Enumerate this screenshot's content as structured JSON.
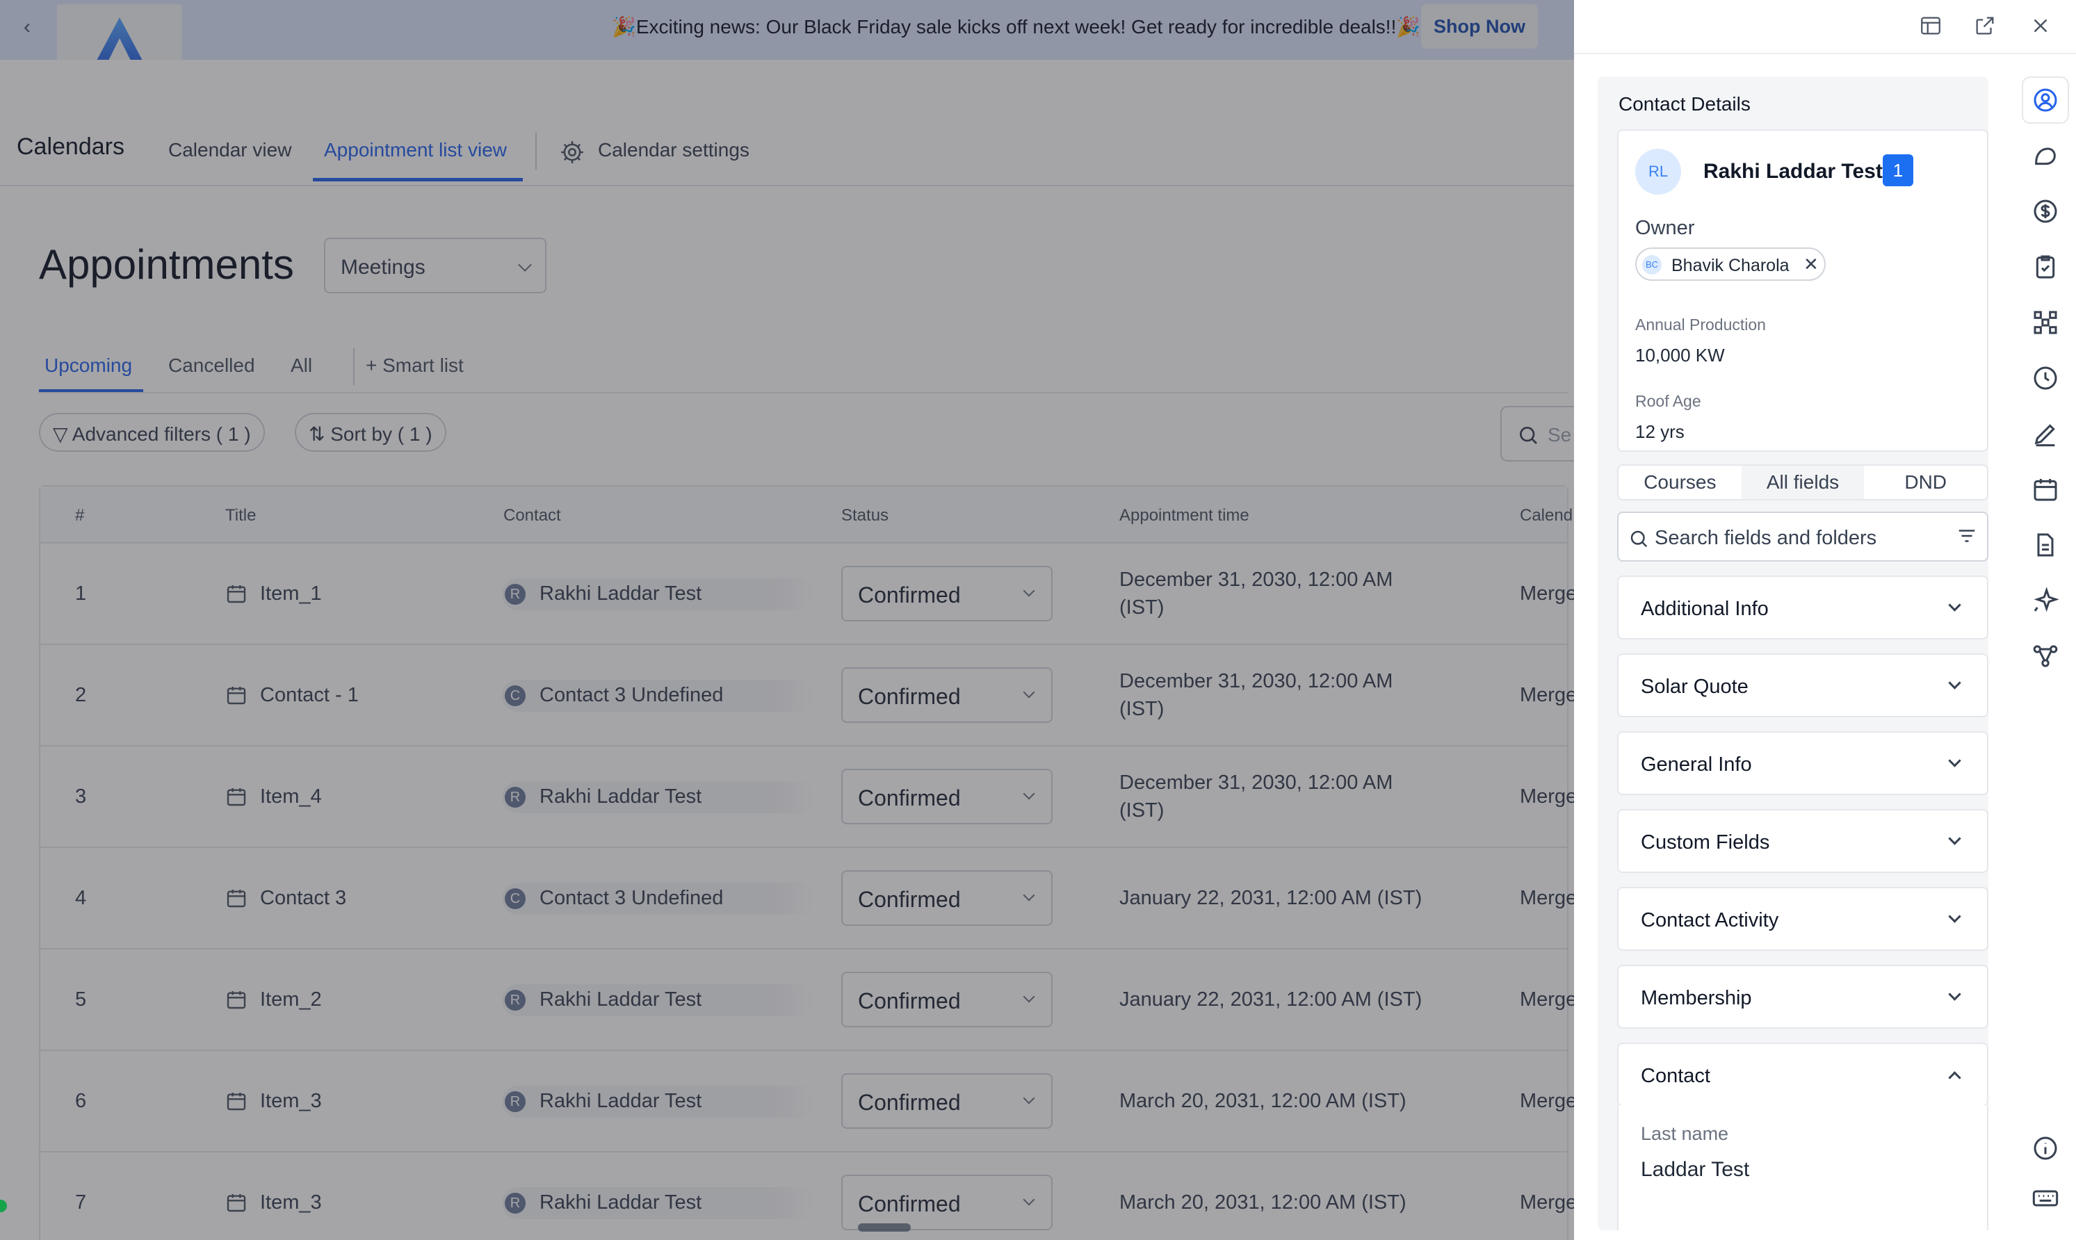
{
  "banner": {
    "message": "🎉Exciting news: Our Black Friday sale kicks off next week! Get ready for incredible deals!!🎉",
    "shop_button": "Shop Now"
  },
  "nav": {
    "brand": "Calendars",
    "tabs": [
      "Calendar view",
      "Appointment list view",
      "Calendar settings"
    ],
    "active_tab": "Appointment list view"
  },
  "page": {
    "title": "Appointments",
    "calendar_select": "Meetings"
  },
  "list_tabs": {
    "items": [
      "Upcoming",
      "Cancelled",
      "All"
    ],
    "active": "Upcoming",
    "smart_list": "+ Smart list"
  },
  "filters": {
    "advanced": "Advanced filters ( 1 )",
    "sort": "Sort by ( 1 )",
    "search_placeholder": "Se"
  },
  "table": {
    "columns": [
      "#",
      "Title",
      "Contact",
      "Status",
      "Appointment time",
      "Calend"
    ],
    "rows": [
      {
        "num": "1",
        "title": "Item_1",
        "contact_initial": "R",
        "contact": "Rakhi Laddar Test",
        "status": "Confirmed",
        "time1": "December 31, 2030, 12:00 AM",
        "time2": "(IST)",
        "calendar": "Merge"
      },
      {
        "num": "2",
        "title": "Contact - 1",
        "contact_initial": "C",
        "contact": "Contact 3 Undefined",
        "status": "Confirmed",
        "time1": "December 31, 2030, 12:00 AM",
        "time2": "(IST)",
        "calendar": "Merge"
      },
      {
        "num": "3",
        "title": "Item_4",
        "contact_initial": "R",
        "contact": "Rakhi Laddar Test",
        "status": "Confirmed",
        "time1": "December 31, 2030, 12:00 AM",
        "time2": "(IST)",
        "calendar": "Merge"
      },
      {
        "num": "4",
        "title": "Contact 3",
        "contact_initial": "C",
        "contact": "Contact 3 Undefined",
        "status": "Confirmed",
        "time1": "January 22, 2031, 12:00 AM (IST)",
        "time2": "",
        "calendar": "Merge"
      },
      {
        "num": "5",
        "title": "Item_2",
        "contact_initial": "R",
        "contact": "Rakhi Laddar Test",
        "status": "Confirmed",
        "time1": "January 22, 2031, 12:00 AM (IST)",
        "time2": "",
        "calendar": "Merge"
      },
      {
        "num": "6",
        "title": "Item_3",
        "contact_initial": "R",
        "contact": "Rakhi Laddar Test",
        "status": "Confirmed",
        "time1": "March 20, 2031, 12:00 AM (IST)",
        "time2": "",
        "calendar": "Merge"
      },
      {
        "num": "7",
        "title": "Item_3",
        "contact_initial": "R",
        "contact": "Rakhi Laddar Test",
        "status": "Confirmed",
        "time1": "March 20, 2031, 12:00 AM (IST)",
        "time2": "",
        "calendar": "Merge"
      }
    ]
  },
  "drawer": {
    "header": "Contact Details",
    "contact": {
      "initials": "RL",
      "name": "Rakhi Laddar Test",
      "badge": "1",
      "owner_label": "Owner",
      "owner_initials": "BC",
      "owner_name": "Bhavik Charola",
      "owner_remove": "✕",
      "annual_label": "Annual Production",
      "annual_value": "10,000 KW",
      "roof_label": "Roof Age",
      "roof_value": "12 yrs"
    },
    "segments": [
      "Courses",
      "All fields",
      "DND"
    ],
    "active_segment": "All fields",
    "search_placeholder": "Search fields and folders",
    "sections": [
      "Additional Info",
      "Solar Quote",
      "General Info",
      "Custom Fields",
      "Contact Activity",
      "Membership",
      "Contact"
    ],
    "expanded_section": {
      "field_label": "Last name",
      "field_value": "Laddar Test"
    }
  },
  "colors": {
    "accent": "#2563eb",
    "badge": "#1d6ff2",
    "banner_bg": "#dbe6fb"
  }
}
